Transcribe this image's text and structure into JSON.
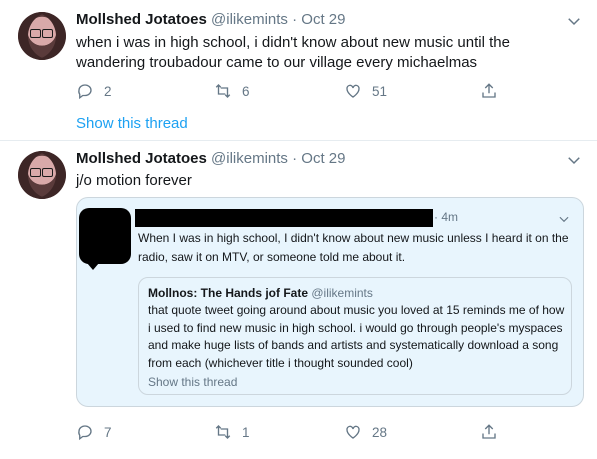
{
  "tweet1": {
    "name": "Mollshed Jotatoes",
    "handle": "@ilikemints",
    "dot": "·",
    "date": "Oct 29",
    "text_line1": "when i was in high school, i didn't know about new music until the",
    "text_line2": "wandering troubadour came to our village every michaelmas",
    "replies": "2",
    "retweets": "6",
    "likes": "51",
    "show_thread": "Show this thread"
  },
  "tweet2": {
    "name": "Mollshed Jotatoes",
    "handle": "@ilikemints",
    "dot": "·",
    "date": "Oct 29",
    "text": "j/o motion forever",
    "replies": "7",
    "retweets": "1",
    "likes": "28",
    "quote": {
      "time": "· 4m",
      "text": "When I was in high school, I didn't know about new music unless I heard it on the radio, saw it on MTV, or someone told me about it.",
      "inner": {
        "name": "Mollnos: The Hands jof Fate",
        "handle": "@ilikemints",
        "text": "that quote tweet going around about music you loved at 15 reminds me of how i used to find new music in high school. i would go through people's myspaces and make huge lists of bands and artists and systematically download a song from each (whichever title i thought sounded cool)",
        "show_thread": "Show this thread"
      }
    }
  },
  "icons": {
    "reply": "reply-icon",
    "retweet": "retweet-icon",
    "like": "heart-icon",
    "share": "share-icon",
    "caret": "chevron-down-icon"
  },
  "colors": {
    "link": "#1da1f2",
    "secondary_text": "#657786",
    "quote_background": "#e8f5fd"
  }
}
